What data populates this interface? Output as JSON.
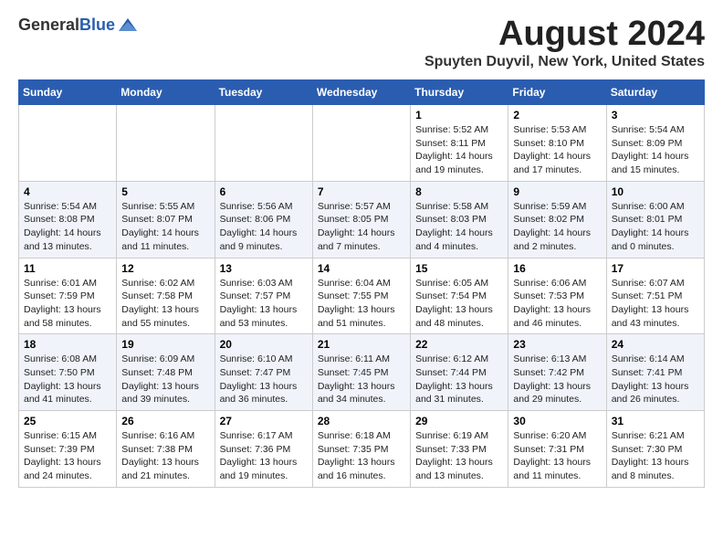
{
  "logo": {
    "general": "General",
    "blue": "Blue"
  },
  "title": "August 2024",
  "location": "Spuyten Duyvil, New York, United States",
  "days_of_week": [
    "Sunday",
    "Monday",
    "Tuesday",
    "Wednesday",
    "Thursday",
    "Friday",
    "Saturday"
  ],
  "weeks": [
    [
      {
        "num": "",
        "detail": ""
      },
      {
        "num": "",
        "detail": ""
      },
      {
        "num": "",
        "detail": ""
      },
      {
        "num": "",
        "detail": ""
      },
      {
        "num": "1",
        "detail": "Sunrise: 5:52 AM\nSunset: 8:11 PM\nDaylight: 14 hours\nand 19 minutes."
      },
      {
        "num": "2",
        "detail": "Sunrise: 5:53 AM\nSunset: 8:10 PM\nDaylight: 14 hours\nand 17 minutes."
      },
      {
        "num": "3",
        "detail": "Sunrise: 5:54 AM\nSunset: 8:09 PM\nDaylight: 14 hours\nand 15 minutes."
      }
    ],
    [
      {
        "num": "4",
        "detail": "Sunrise: 5:54 AM\nSunset: 8:08 PM\nDaylight: 14 hours\nand 13 minutes."
      },
      {
        "num": "5",
        "detail": "Sunrise: 5:55 AM\nSunset: 8:07 PM\nDaylight: 14 hours\nand 11 minutes."
      },
      {
        "num": "6",
        "detail": "Sunrise: 5:56 AM\nSunset: 8:06 PM\nDaylight: 14 hours\nand 9 minutes."
      },
      {
        "num": "7",
        "detail": "Sunrise: 5:57 AM\nSunset: 8:05 PM\nDaylight: 14 hours\nand 7 minutes."
      },
      {
        "num": "8",
        "detail": "Sunrise: 5:58 AM\nSunset: 8:03 PM\nDaylight: 14 hours\nand 4 minutes."
      },
      {
        "num": "9",
        "detail": "Sunrise: 5:59 AM\nSunset: 8:02 PM\nDaylight: 14 hours\nand 2 minutes."
      },
      {
        "num": "10",
        "detail": "Sunrise: 6:00 AM\nSunset: 8:01 PM\nDaylight: 14 hours\nand 0 minutes."
      }
    ],
    [
      {
        "num": "11",
        "detail": "Sunrise: 6:01 AM\nSunset: 7:59 PM\nDaylight: 13 hours\nand 58 minutes."
      },
      {
        "num": "12",
        "detail": "Sunrise: 6:02 AM\nSunset: 7:58 PM\nDaylight: 13 hours\nand 55 minutes."
      },
      {
        "num": "13",
        "detail": "Sunrise: 6:03 AM\nSunset: 7:57 PM\nDaylight: 13 hours\nand 53 minutes."
      },
      {
        "num": "14",
        "detail": "Sunrise: 6:04 AM\nSunset: 7:55 PM\nDaylight: 13 hours\nand 51 minutes."
      },
      {
        "num": "15",
        "detail": "Sunrise: 6:05 AM\nSunset: 7:54 PM\nDaylight: 13 hours\nand 48 minutes."
      },
      {
        "num": "16",
        "detail": "Sunrise: 6:06 AM\nSunset: 7:53 PM\nDaylight: 13 hours\nand 46 minutes."
      },
      {
        "num": "17",
        "detail": "Sunrise: 6:07 AM\nSunset: 7:51 PM\nDaylight: 13 hours\nand 43 minutes."
      }
    ],
    [
      {
        "num": "18",
        "detail": "Sunrise: 6:08 AM\nSunset: 7:50 PM\nDaylight: 13 hours\nand 41 minutes."
      },
      {
        "num": "19",
        "detail": "Sunrise: 6:09 AM\nSunset: 7:48 PM\nDaylight: 13 hours\nand 39 minutes."
      },
      {
        "num": "20",
        "detail": "Sunrise: 6:10 AM\nSunset: 7:47 PM\nDaylight: 13 hours\nand 36 minutes."
      },
      {
        "num": "21",
        "detail": "Sunrise: 6:11 AM\nSunset: 7:45 PM\nDaylight: 13 hours\nand 34 minutes."
      },
      {
        "num": "22",
        "detail": "Sunrise: 6:12 AM\nSunset: 7:44 PM\nDaylight: 13 hours\nand 31 minutes."
      },
      {
        "num": "23",
        "detail": "Sunrise: 6:13 AM\nSunset: 7:42 PM\nDaylight: 13 hours\nand 29 minutes."
      },
      {
        "num": "24",
        "detail": "Sunrise: 6:14 AM\nSunset: 7:41 PM\nDaylight: 13 hours\nand 26 minutes."
      }
    ],
    [
      {
        "num": "25",
        "detail": "Sunrise: 6:15 AM\nSunset: 7:39 PM\nDaylight: 13 hours\nand 24 minutes."
      },
      {
        "num": "26",
        "detail": "Sunrise: 6:16 AM\nSunset: 7:38 PM\nDaylight: 13 hours\nand 21 minutes."
      },
      {
        "num": "27",
        "detail": "Sunrise: 6:17 AM\nSunset: 7:36 PM\nDaylight: 13 hours\nand 19 minutes."
      },
      {
        "num": "28",
        "detail": "Sunrise: 6:18 AM\nSunset: 7:35 PM\nDaylight: 13 hours\nand 16 minutes."
      },
      {
        "num": "29",
        "detail": "Sunrise: 6:19 AM\nSunset: 7:33 PM\nDaylight: 13 hours\nand 13 minutes."
      },
      {
        "num": "30",
        "detail": "Sunrise: 6:20 AM\nSunset: 7:31 PM\nDaylight: 13 hours\nand 11 minutes."
      },
      {
        "num": "31",
        "detail": "Sunrise: 6:21 AM\nSunset: 7:30 PM\nDaylight: 13 hours\nand 8 minutes."
      }
    ]
  ]
}
